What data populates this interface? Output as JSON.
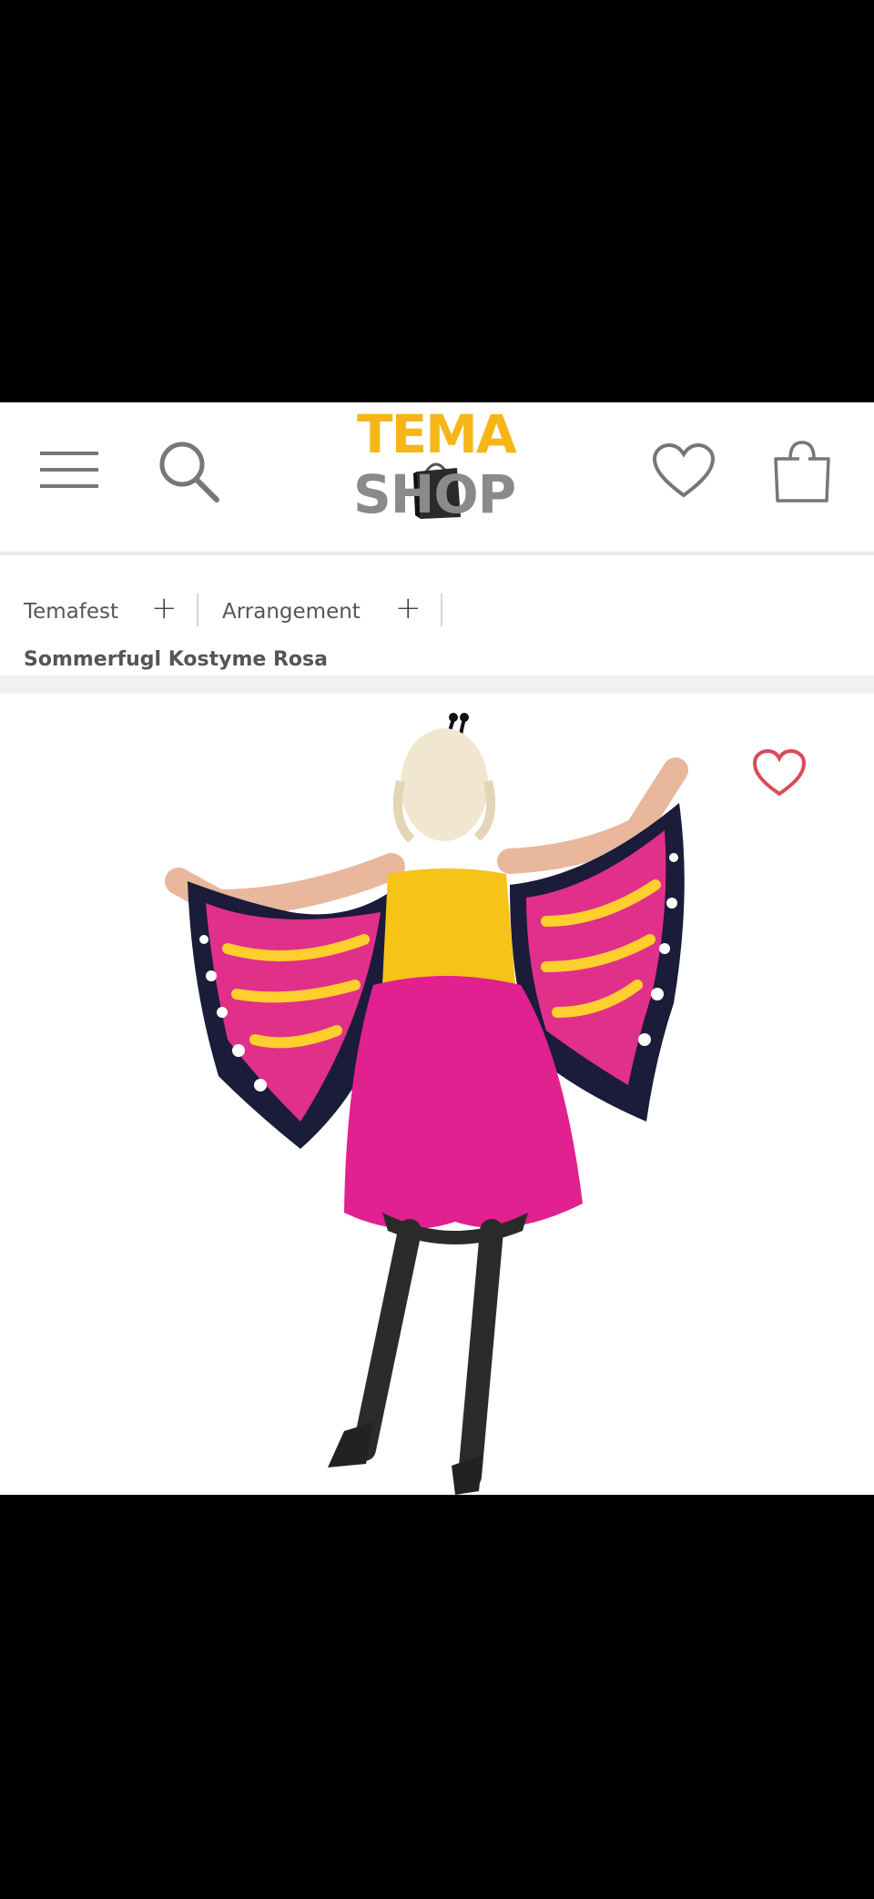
{
  "header": {
    "logo_top": "TEMA",
    "logo_bottom": "SHOP"
  },
  "nav": {
    "items": [
      {
        "label": "Temafest",
        "expand": "+"
      },
      {
        "label": "Arrangement",
        "expand": "+"
      }
    ]
  },
  "product": {
    "title": "Sommerfugl Kostyme Rosa"
  },
  "colors": {
    "brand_yellow": "#f6b618",
    "brand_gray": "#8a8a8a",
    "wishlist_red": "#d94a5a"
  },
  "icons": [
    "menu-icon",
    "search-icon",
    "heart-icon",
    "shopping-bag-icon",
    "wishlist-heart-icon"
  ]
}
